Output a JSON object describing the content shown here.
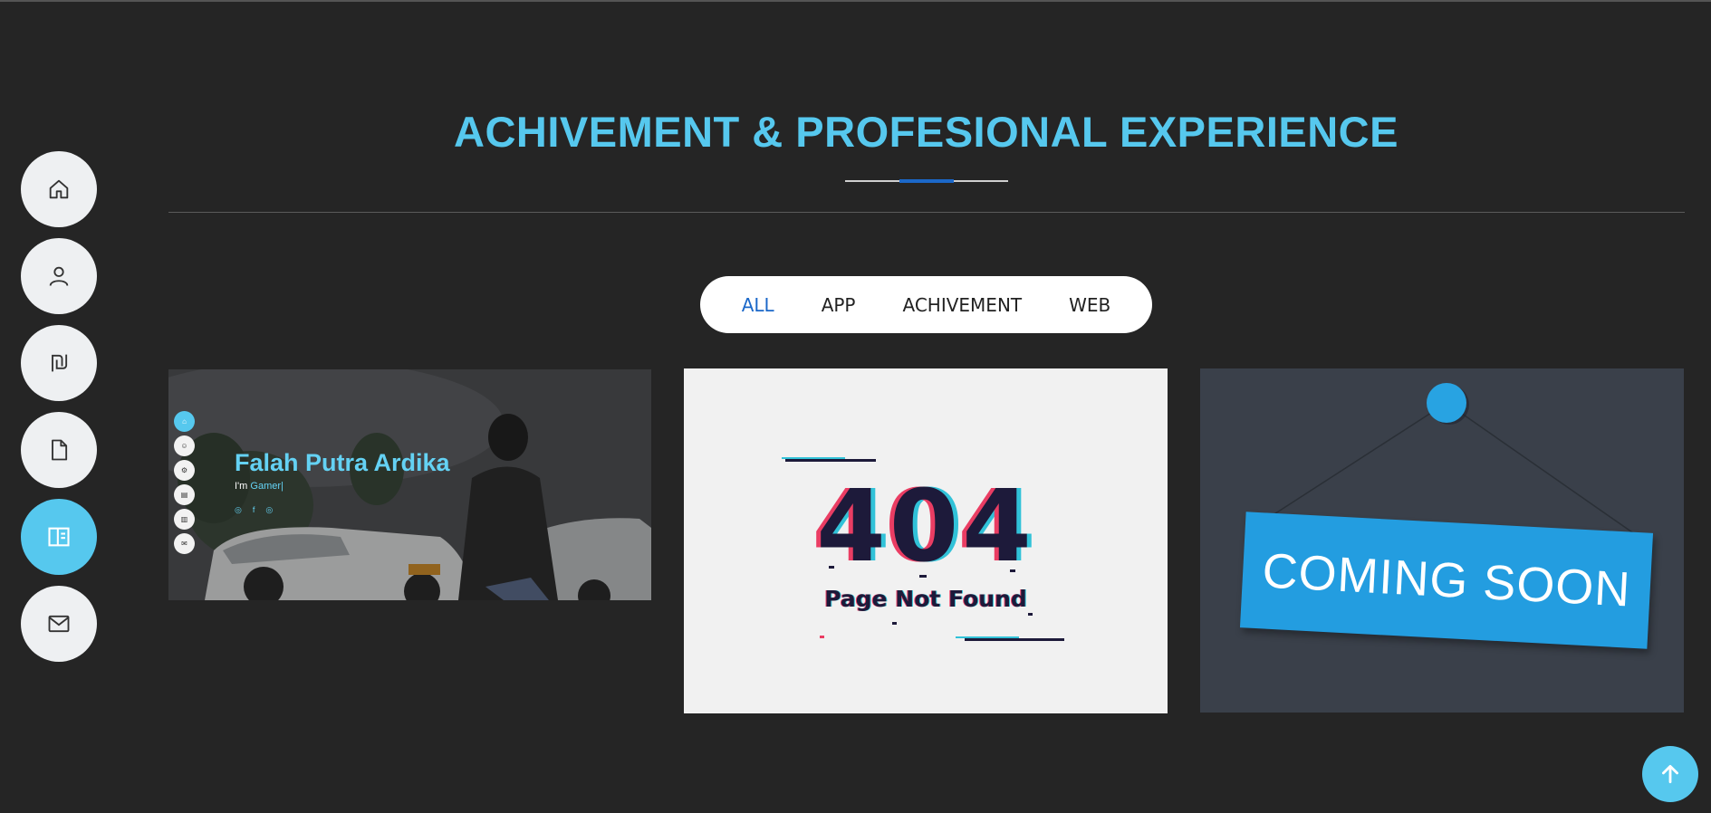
{
  "side_nav": {
    "items": [
      {
        "icon": "home-icon",
        "active": false
      },
      {
        "icon": "user-icon",
        "active": false
      },
      {
        "icon": "shekel-icon",
        "active": false
      },
      {
        "icon": "file-icon",
        "active": false
      },
      {
        "icon": "portfolio-icon",
        "active": true
      },
      {
        "icon": "mail-icon",
        "active": false
      }
    ]
  },
  "section": {
    "title": "ACHIVEMENT & PROFESIONAL EXPERIENCE"
  },
  "filters": {
    "items": [
      "ALL",
      "APP",
      "ACHIVEMENT",
      "WEB"
    ],
    "active": "ALL"
  },
  "cards": {
    "card1": {
      "name": "Falah Putra Ardika",
      "sub_prefix": "I'm ",
      "sub_highlight": "Gamer|"
    },
    "card2": {
      "code": "404",
      "message": "Page Not Found"
    },
    "card3": {
      "sign_text": "COMING SOON"
    }
  },
  "colors": {
    "accent": "#56c8ee",
    "active_filter": "#1b68c9",
    "background": "#252525"
  }
}
